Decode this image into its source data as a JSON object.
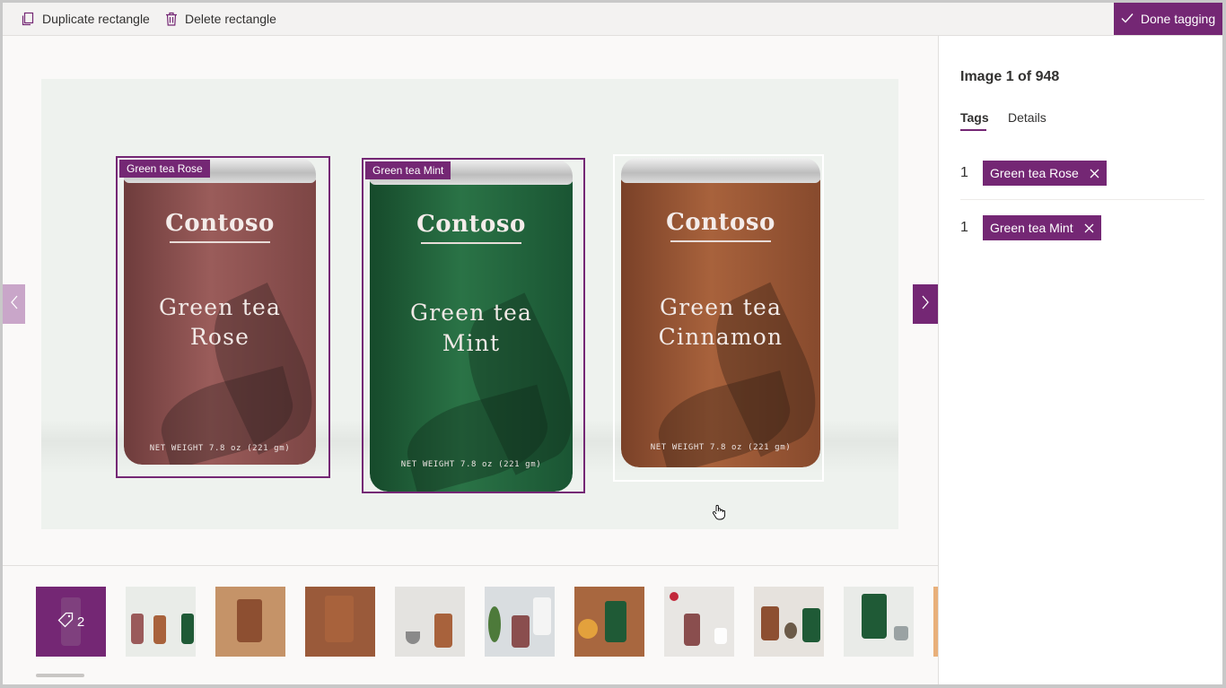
{
  "toolbar": {
    "duplicate_label": "Duplicate rectangle",
    "delete_label": "Delete rectangle",
    "done_label": "Done tagging"
  },
  "canvas": {
    "cans": [
      {
        "brand": "Contoso",
        "name_line1": "Green tea",
        "name_line2": "Rose",
        "weight": "NET WEIGHT 7.8 oz (221 gm)",
        "color": "#8a4e4e"
      },
      {
        "brand": "Contoso",
        "name_line1": "Green tea",
        "name_line2": "Mint",
        "weight": "NET WEIGHT 7.8 oz (221 gm)",
        "color": "#1f5a36"
      },
      {
        "brand": "Contoso",
        "name_line1": "Green tea",
        "name_line2": "Cinnamon",
        "weight": "NET WEIGHT 7.8 oz (221 gm)",
        "color": "#8d4f31"
      }
    ],
    "regions": [
      {
        "tag": "Green tea Rose"
      },
      {
        "tag": "Green tea Mint"
      }
    ]
  },
  "filmstrip": {
    "selected_tag_count": "2",
    "thumbnails": [
      {
        "icon": "tag-icon",
        "bg": "#742774"
      },
      {
        "bg": "#e9ece8"
      },
      {
        "bg": "#c59368"
      },
      {
        "bg": "#9a5a3a"
      },
      {
        "bg": "#e4e3e0"
      },
      {
        "bg": "#d9dde0"
      },
      {
        "bg": "#a8673f"
      },
      {
        "bg": "#e8e6e3"
      },
      {
        "bg": "#e6e2dd"
      },
      {
        "bg": "#e9ebe8"
      },
      {
        "bg": "#e9b07a"
      }
    ]
  },
  "pane": {
    "image_count": "Image 1 of 948",
    "tabs": [
      {
        "label": "Tags"
      },
      {
        "label": "Details"
      }
    ],
    "tags": [
      {
        "count": "1",
        "label": "Green tea Rose"
      },
      {
        "count": "1",
        "label": "Green tea Mint"
      }
    ]
  },
  "colors": {
    "accent": "#742774",
    "accent_light": "#c9a6c9"
  }
}
